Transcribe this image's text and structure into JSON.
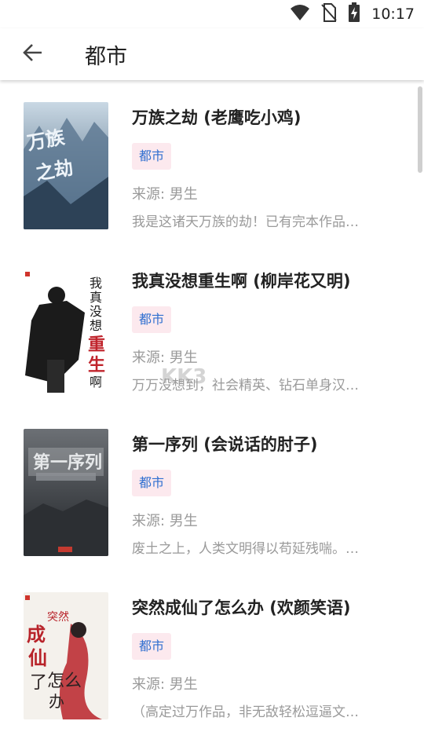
{
  "status_bar": {
    "time": "10:17",
    "icons": [
      "wifi-icon",
      "no-sim-icon",
      "battery-charging-icon"
    ]
  },
  "app_bar": {
    "back_icon": "arrow-left-icon",
    "title": "都市"
  },
  "books": [
    {
      "title": "万族之劫 (老鹰吃小鸡)",
      "tag": "都市",
      "source": "来源: 男生",
      "desc": "我是这诸天万族的劫！已有完本作品…",
      "cover_text": "万族之劫",
      "cover_color": "#6b8aa8"
    },
    {
      "title": "我真没想重生啊 (柳岸花又明)",
      "tag": "都市",
      "source": "来源: 男生",
      "desc": "万万没想到，社会精英、钻石单身汉…",
      "cover_text": "我真没想重生啊",
      "cover_color": "#ffffff"
    },
    {
      "title": "第一序列 (会说话的肘子)",
      "tag": "都市",
      "source": "来源: 男生",
      "desc": "废土之上，人类文明得以苟延残喘。…",
      "cover_text": "第一序列",
      "cover_color": "#4a4e52"
    },
    {
      "title": "突然成仙了怎么办 (欢颜笑语)",
      "tag": "都市",
      "source": "来源: 男生",
      "desc": "（高定过万作品，非无敌轻松逗逼文…",
      "cover_text": "突然成仙了怎么办",
      "cover_color": "#f4f1ec"
    }
  ],
  "watermark": "KK3"
}
